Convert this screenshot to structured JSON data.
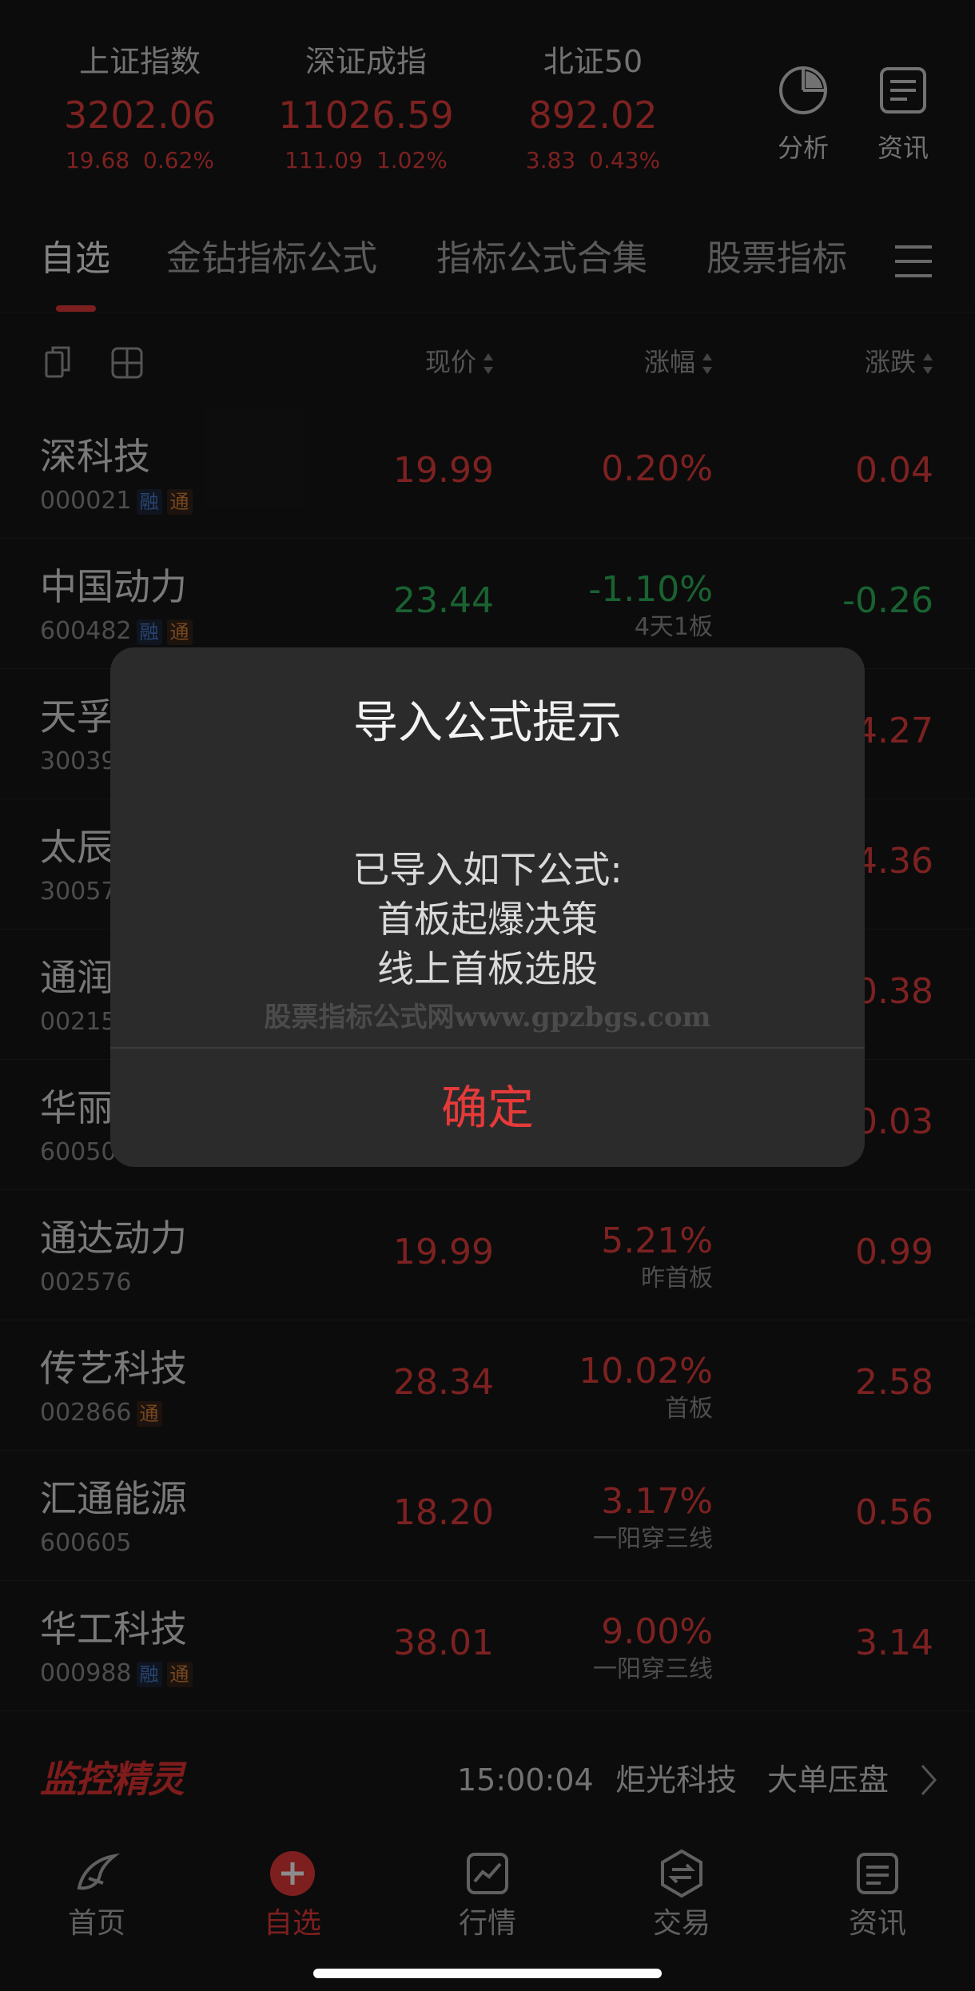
{
  "indices": [
    {
      "name": "上证指数",
      "price": "3202.06",
      "change": "19.68  0.62%"
    },
    {
      "name": "深证成指",
      "price": "11026.59",
      "change": "111.09  1.02%"
    },
    {
      "name": "北证50",
      "price": "892.02",
      "change": "3.83  0.43%"
    }
  ],
  "top_buttons": {
    "analysis": "分析",
    "news": "资讯"
  },
  "tabs": [
    "自选",
    "金钻指标公式",
    "指标公式合集",
    "股票指标"
  ],
  "columns": {
    "price": "现价",
    "pct": "涨幅",
    "chg": "涨跌"
  },
  "stocks": [
    {
      "name": "深科技",
      "code": "000021",
      "tags": [
        "融",
        "通"
      ],
      "price": "19.99",
      "pct": "0.20%",
      "note": "",
      "chg": "0.04",
      "dir": "up"
    },
    {
      "name": "中国动力",
      "code": "600482",
      "tags": [
        "融",
        "通"
      ],
      "price": "23.44",
      "pct": "-1.10%",
      "note": "4天1板",
      "chg": "-0.26",
      "dir": "down"
    },
    {
      "name": "天孚",
      "code": "30039",
      "tags": [],
      "price": "",
      "pct": "",
      "note": "",
      "chg": "4.27",
      "dir": "up"
    },
    {
      "name": "太辰",
      "code": "30057",
      "tags": [],
      "price": "",
      "pct": "",
      "note": "",
      "chg": "4.36",
      "dir": "up"
    },
    {
      "name": "通润",
      "code": "00215",
      "tags": [],
      "price": "",
      "pct": "",
      "note": "",
      "chg": "0.38",
      "dir": "up"
    },
    {
      "name": "华丽",
      "code": "60050",
      "tags": [],
      "price": "",
      "pct": "",
      "note": "",
      "chg": "0.03",
      "dir": "up"
    },
    {
      "name": "通达动力",
      "code": "002576",
      "tags": [],
      "price": "19.99",
      "pct": "5.21%",
      "note": "昨首板",
      "chg": "0.99",
      "dir": "up"
    },
    {
      "name": "传艺科技",
      "code": "002866",
      "tags": [
        "通"
      ],
      "price": "28.34",
      "pct": "10.02%",
      "note": "首板",
      "chg": "2.58",
      "dir": "up"
    },
    {
      "name": "汇通能源",
      "code": "600605",
      "tags": [],
      "price": "18.20",
      "pct": "3.17%",
      "note": "一阳穿三线",
      "chg": "0.56",
      "dir": "up"
    },
    {
      "name": "华工科技",
      "code": "000988",
      "tags": [
        "融",
        "通"
      ],
      "price": "38.01",
      "pct": "9.00%",
      "note": "一阳穿三线",
      "chg": "3.14",
      "dir": "up"
    }
  ],
  "monitor": {
    "logo": "监控精灵",
    "time": "15:00:04",
    "stock": "炬光科技",
    "event": "大单压盘"
  },
  "nav": [
    "首页",
    "自选",
    "行情",
    "交易",
    "资讯"
  ],
  "dialog": {
    "title": "导入公式提示",
    "line1": "已导入如下公式:",
    "line2": "首板起爆决策",
    "line3": "线上首板选股",
    "watermark": "股票指标公式网www.gpzbgs.com",
    "confirm": "确定"
  },
  "colors": {
    "up": "#e43c3c",
    "down": "#2fb35a",
    "accent": "#e63a3a",
    "background": "#171717"
  }
}
